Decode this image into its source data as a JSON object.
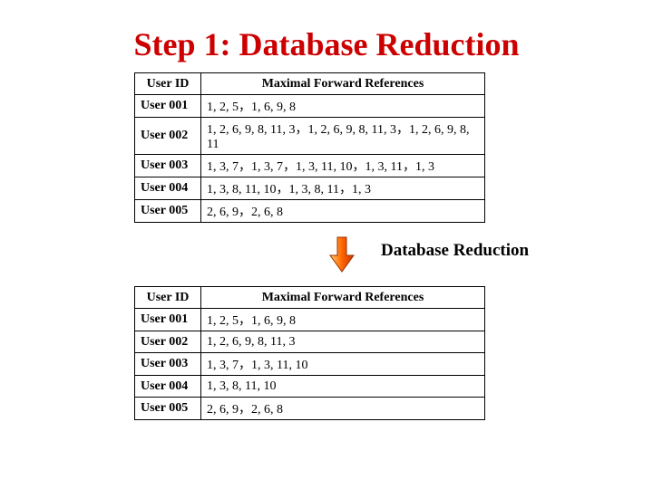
{
  "title": "Step 1: Database Reduction",
  "header": {
    "user": "User ID",
    "ref": "Maximal Forward References"
  },
  "table1": [
    {
      "user": "User 001",
      "ref": "1, 2, 5，1, 6, 9, 8"
    },
    {
      "user": "User 002",
      "ref": "1, 2, 6, 9, 8, 11, 3，1, 2, 6, 9, 8, 11, 3，1, 2, 6, 9, 8, 11"
    },
    {
      "user": "User 003",
      "ref": "1, 3, 7，1, 3, 7，1, 3, 11, 10，1, 3, 11，1, 3"
    },
    {
      "user": "User 004",
      "ref": "1, 3, 8, 11, 10，1, 3, 8, 11，1, 3"
    },
    {
      "user": "User 005",
      "ref": "2, 6, 9，2, 6, 8"
    }
  ],
  "arrow_label": "Database Reduction",
  "table2": [
    {
      "user": "User 001",
      "ref": "1, 2, 5，1, 6, 9, 8"
    },
    {
      "user": "User 002",
      "ref": "1, 2, 6, 9, 8, 11, 3"
    },
    {
      "user": "User 003",
      "ref": "1, 3, 7，1, 3, 11, 10"
    },
    {
      "user": "User 004",
      "ref": "1, 3, 8, 11, 10"
    },
    {
      "user": "User 005",
      "ref": "2, 6, 9，2, 6, 8"
    }
  ]
}
